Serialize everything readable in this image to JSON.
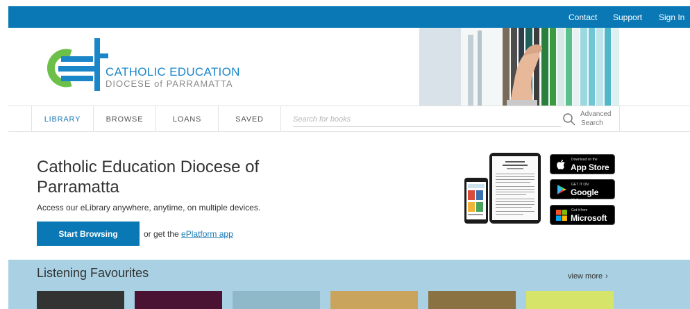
{
  "topbar": {
    "links": [
      "Contact",
      "Support",
      "Sign In"
    ]
  },
  "logo": {
    "line1": "CATHOLIC EDUCATION",
    "line2": "DIOCESE of PARRAMATTA"
  },
  "nav": {
    "items": [
      "LIBRARY",
      "BROWSE",
      "LOANS",
      "SAVED"
    ],
    "active": "LIBRARY",
    "search_placeholder": "Search for books",
    "advanced_line1": "Advanced",
    "advanced_line2": "Search"
  },
  "main": {
    "title": "Catholic Education Diocese of Parramatta",
    "tagline": "Access our eLibrary anywhere, anytime, on multiple devices.",
    "start_button": "Start Browsing",
    "or_text": "or get the ",
    "app_link": "ePlatform app"
  },
  "badges": [
    {
      "small": "Download on the",
      "big": "App Store",
      "icon": "apple-icon"
    },
    {
      "small": "GET IT ON",
      "big": "Google Play",
      "icon": "google-play-icon"
    },
    {
      "small": "Get it from",
      "big": "Microsoft",
      "icon": "microsoft-icon"
    }
  ],
  "favourites": {
    "title": "Listening Favourites",
    "view_more": "view more",
    "book_colors": [
      "#333333",
      "#4a1233",
      "#8fb8c9",
      "#c9a45c",
      "#8b7242",
      "#d6e46a"
    ]
  },
  "colors": {
    "brand_blue": "#0a78b4",
    "logo_green": "#6cc04a",
    "section_bg": "#a9d1e3"
  }
}
